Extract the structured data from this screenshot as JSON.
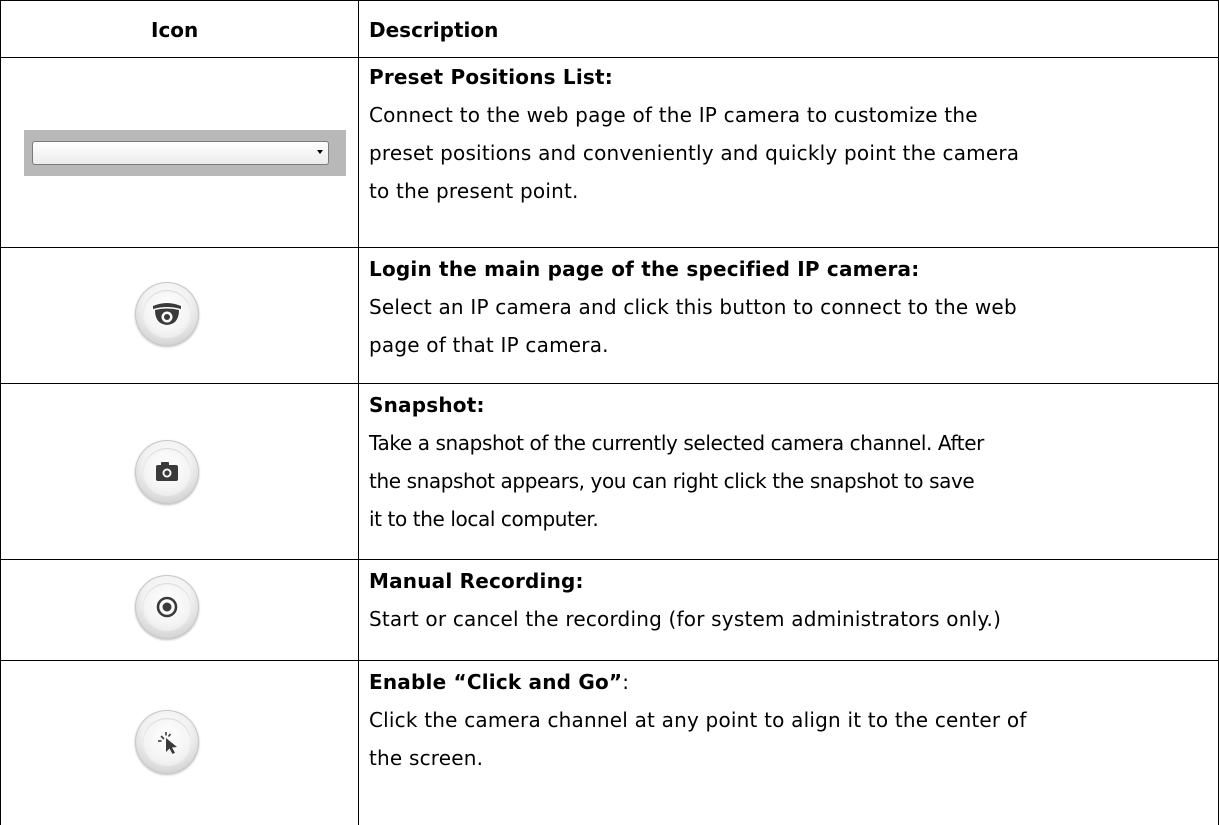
{
  "table": {
    "headers": {
      "icon": "Icon",
      "description": "Description"
    },
    "rows": [
      {
        "icon": "dropdown-list-icon",
        "title": "Preset Positions List:",
        "lines": [
          "Connect to the web page of the IP camera to customize the",
          "preset positions and conveniently and quickly point the camera",
          "to the present point."
        ]
      },
      {
        "icon": "ip-camera-icon",
        "title": "Login the main page of the specified IP camera:",
        "lines": [
          "Select an IP camera and click this button to connect to the web",
          "page of that IP camera."
        ]
      },
      {
        "icon": "camera-snapshot-icon",
        "title": "Snapshot:",
        "lines": [
          "Take a snapshot of the currently selected camera channel. After",
          "the snapshot appears, you can right click the snapshot to save",
          "it to the local computer."
        ]
      },
      {
        "icon": "record-icon",
        "title": "Manual Recording:",
        "lines": [
          "Start or cancel the recording (for system administrators only.)"
        ]
      },
      {
        "icon": "click-and-go-cursor-icon",
        "title": "Enable “Click and Go”",
        "title_suffix": ":",
        "lines": [
          "Click the camera channel at any point to align it to the center of",
          "the screen."
        ]
      }
    ]
  }
}
